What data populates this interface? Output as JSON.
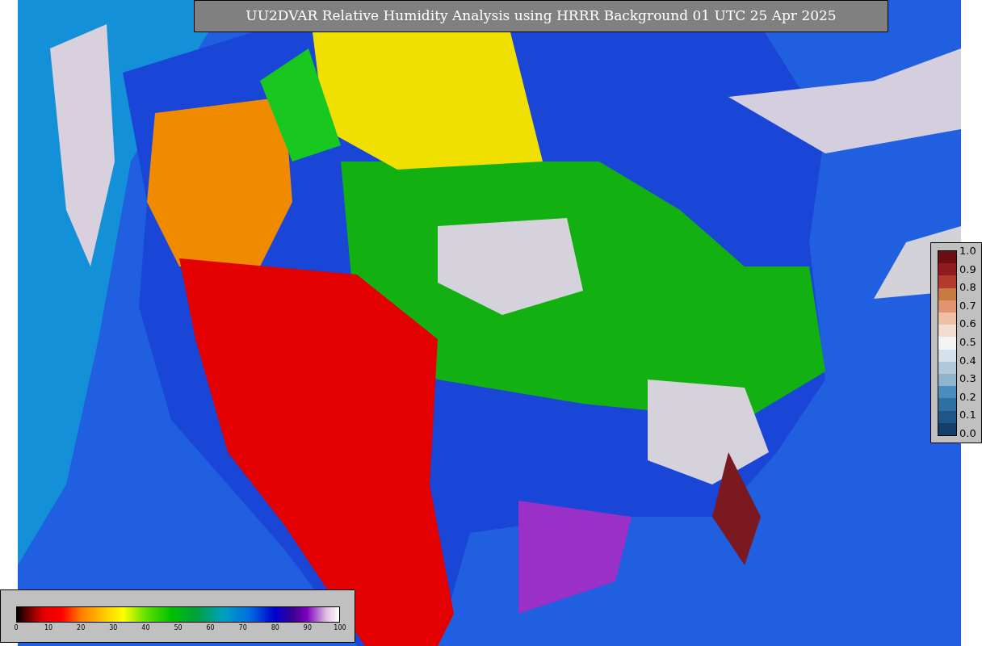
{
  "title": "UU2DVAR Relative Humidity Analysis using HRRR Background 01 UTC 25 Apr 2025",
  "right_colorbar": {
    "ticks": [
      "1.0",
      "0.9",
      "0.8",
      "0.7",
      "0.6",
      "0.5",
      "0.4",
      "0.3",
      "0.2",
      "0.1",
      "0.0"
    ]
  },
  "bottom_colorbar": {
    "ticks": [
      "0",
      "10",
      "20",
      "30",
      "40",
      "50",
      "60",
      "70",
      "80",
      "90",
      "100"
    ]
  }
}
